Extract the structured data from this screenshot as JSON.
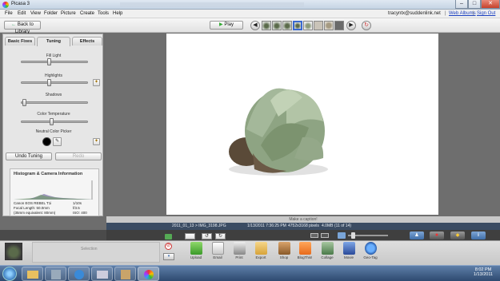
{
  "window": {
    "title": "Picasa 3",
    "controls": {
      "minimize": "–",
      "maximize": "□",
      "close": "✕"
    }
  },
  "menu": {
    "items": [
      "File",
      "Edit",
      "View",
      "Folder",
      "Picture",
      "Create",
      "Tools",
      "Help"
    ]
  },
  "account": {
    "email": "tracyntx@suddenlink.net",
    "separator": "|",
    "web_albums": "Web Albums",
    "sign_out": "Sign Out"
  },
  "toolbar": {
    "back_label": "Back to Library",
    "play_label": "Play",
    "back_arrow": "←",
    "prev_arrow": "◀",
    "next_arrow": "▶"
  },
  "panel": {
    "tabs": [
      "Basic Fixes",
      "Tuning",
      "Effects"
    ],
    "active_tab": "Tuning",
    "sliders": [
      {
        "label": "Fill Light",
        "value": 0.42
      },
      {
        "label": "Highlights",
        "value": 0.42
      },
      {
        "label": "Shadows",
        "value": 0.02
      }
    ],
    "color_temperature": {
      "label": "Color Temperature",
      "value": 0.45
    },
    "neutral_picker_label": "Neutral Color Picker",
    "undo_label": "Undo Tuning",
    "redo_label": "Redo"
  },
  "histogram": {
    "title": "Histogram & Camera Information",
    "camera": "Canon EOS REBEL T1i",
    "focal_length_label": "Focal Length: 50.0mm",
    "focal_35mm_label": "(35mm equivalent: 80mm)",
    "shutter": "1/10s",
    "aperture": "f/3.5",
    "iso": "ISO: 400"
  },
  "photo": {
    "caption_placeholder": "Make a caption!"
  },
  "infobar": {
    "filename": "2011_01_13 > IMG_3198.JPG",
    "datetime": "1/13/2011 7:36:25 PM",
    "dimensions": "4752x3168 pixels",
    "filesize": "4.0MB",
    "position": "(11 of 14)"
  },
  "tray": {
    "selection_label": "Selection"
  },
  "actions": [
    "Upload",
    "Email",
    "Print",
    "Export",
    "Shop",
    "BlogThis!",
    "Collage",
    "Movie",
    "Geo-Tag"
  ],
  "clock": {
    "time": "8:02 PM",
    "date": "1/13/2011"
  },
  "colors": {
    "infobar": "#3b4c63",
    "photo_bg": "#ffffff",
    "workspace": "#6e6e6e",
    "link": "#1a3fc0"
  }
}
